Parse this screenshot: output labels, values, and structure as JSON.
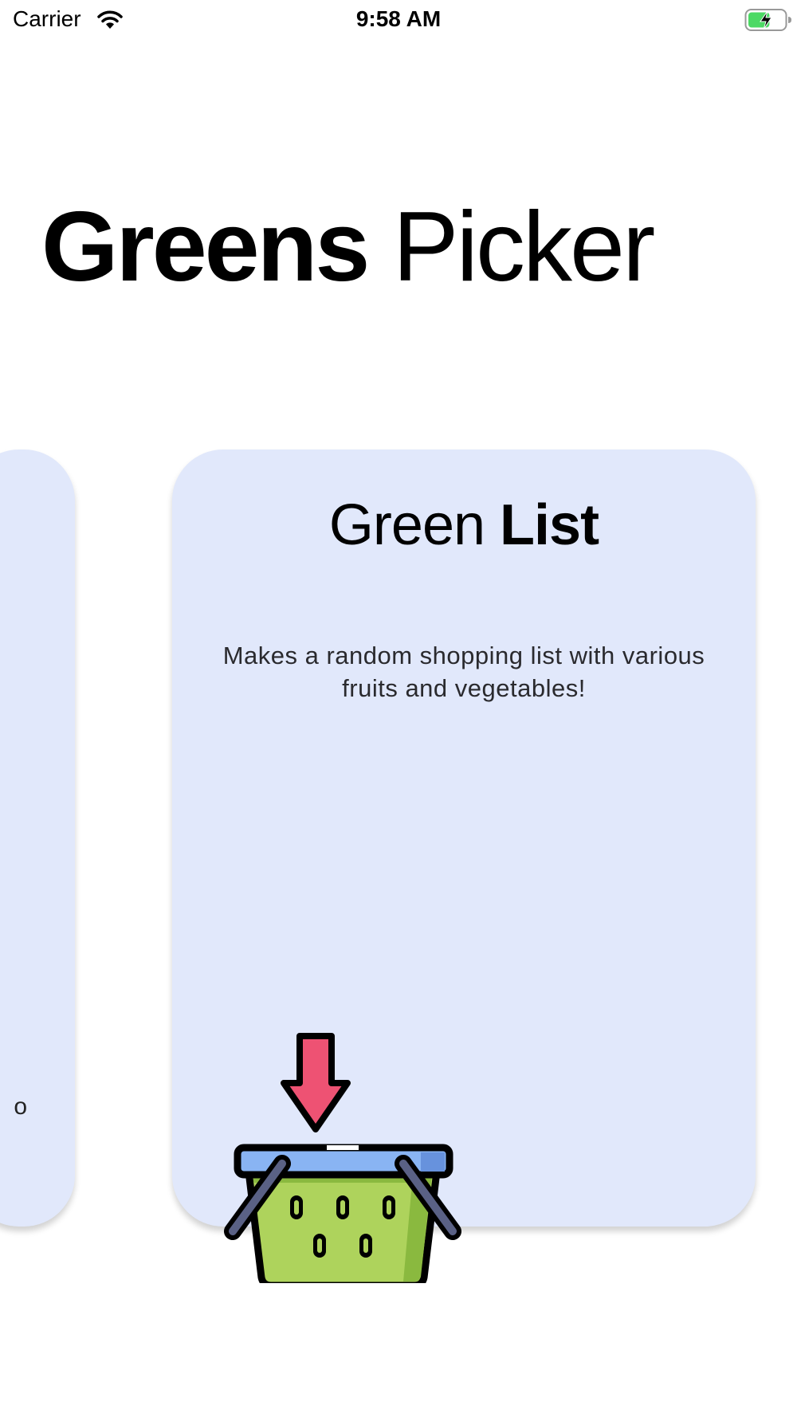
{
  "status_bar": {
    "carrier": "Carrier",
    "time": "9:58 AM",
    "wifi_icon": "wifi-icon",
    "battery_icon": "battery-charging-icon",
    "battery_fill_fraction": 0.6,
    "battery_color": "#4cd964"
  },
  "header": {
    "title_bold": "Greens",
    "title_regular": "Picker"
  },
  "carousel": {
    "previous_card": {
      "partial_text": "o"
    },
    "current_card": {
      "title_regular": "Green",
      "title_bold": "List",
      "description": "Makes a random shopping list with various fruits and vegetables!",
      "illustration_icon": "shopping-basket-icon"
    }
  },
  "colors": {
    "card_background": "#e1e8fb",
    "arrow": "#ee5273",
    "basket_body": "#aed35c",
    "basket_rim": "#89b4f3"
  }
}
